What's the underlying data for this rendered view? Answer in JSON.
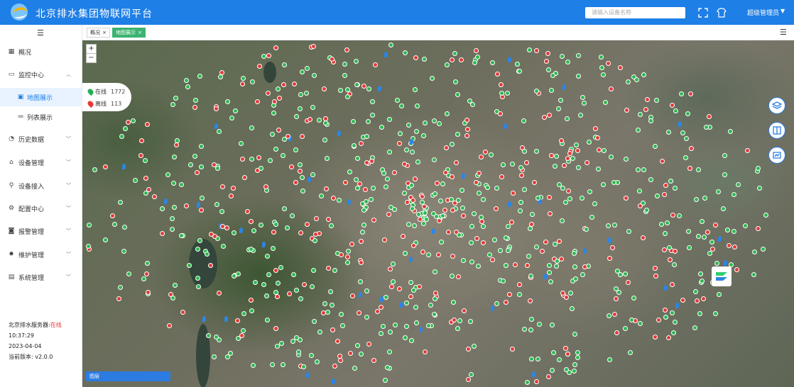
{
  "header": {
    "title": "北京排水集团物联网平台",
    "search_placeholder": "请输入设备名称",
    "user_name": "超级管理员",
    "brand_color": "#1e7fe6"
  },
  "sidebar": {
    "items": [
      {
        "label": "概况",
        "icon": "grid-icon"
      },
      {
        "label": "监控中心",
        "icon": "monitor-icon",
        "expanded": true
      },
      {
        "label": "地图展示",
        "icon": "map-icon",
        "active": true
      },
      {
        "label": "列表展示",
        "icon": "list-icon"
      },
      {
        "label": "历史数据",
        "icon": "history-icon"
      },
      {
        "label": "设备管理",
        "icon": "device-icon"
      },
      {
        "label": "设备接入",
        "icon": "connect-icon"
      },
      {
        "label": "配置中心",
        "icon": "config-icon"
      },
      {
        "label": "报警管理",
        "icon": "alarm-icon"
      },
      {
        "label": "维护管理",
        "icon": "maintain-icon"
      },
      {
        "label": "系统管理",
        "icon": "system-icon"
      }
    ],
    "status": {
      "server_label": "北京排水服务器:",
      "server_state": "在线",
      "time": "10:37:29",
      "date": "2023-04-04",
      "version_label": "当前版本:",
      "version": "v2.0.0"
    }
  },
  "tabs": [
    {
      "label": "概况",
      "active": false
    },
    {
      "label": "地图展示",
      "active": true
    }
  ],
  "map": {
    "zoom_in": "+",
    "zoom_out": "−",
    "legend": {
      "online_label": "在线",
      "online_count": "1772",
      "offline_label": "离线",
      "offline_count": "113",
      "online_color": "#20b050",
      "offline_color": "#e53935"
    },
    "layer_button": "图层"
  }
}
